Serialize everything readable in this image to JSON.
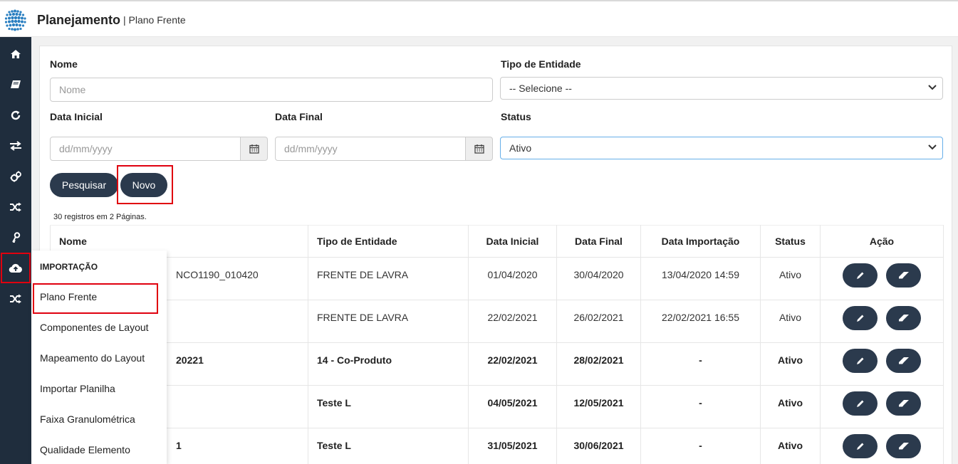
{
  "header": {
    "title": "Planejamento",
    "subtitle": "| Plano Frente"
  },
  "sidebar": {
    "icons": [
      "home-icon",
      "book-icon",
      "refresh-icon",
      "exchange-icon",
      "gears-icon",
      "shuffle-icon",
      "key-icon",
      "cloud-upload-icon",
      "random-icon"
    ]
  },
  "flyout": {
    "heading": "IMPORTAÇÃO",
    "items": [
      "Plano Frente",
      "Componentes de Layout",
      "Mapeamento do Layout",
      "Importar Planilha",
      "Faixa Granulométrica",
      "Qualidade Elemento"
    ]
  },
  "filters": {
    "nome_label": "Nome",
    "nome_placeholder": "Nome",
    "tipo_label": "Tipo de Entidade",
    "tipo_value": "-- Selecione --",
    "data_inicial_label": "Data Inicial",
    "data_final_label": "Data Final",
    "date_placeholder": "dd/mm/yyyy",
    "status_label": "Status",
    "status_value": "Ativo"
  },
  "buttons": {
    "search": "Pesquisar",
    "new": "Novo"
  },
  "records_text": "30 registros em 2 Páginas.",
  "table": {
    "headers": [
      "Nome",
      "Tipo de Entidade",
      "Data Inicial",
      "Data Final",
      "Data Importação",
      "Status",
      "Ação"
    ],
    "rows": [
      {
        "nome": "NCO1190_010420",
        "tipo": "FRENTE DE LAVRA",
        "data_inicial": "01/04/2020",
        "data_final": "30/04/2020",
        "data_importacao": "13/04/2020 14:59",
        "status": "Ativo",
        "bold": false
      },
      {
        "nome": "",
        "tipo": "FRENTE DE LAVRA",
        "data_inicial": "22/02/2021",
        "data_final": "26/02/2021",
        "data_importacao": "22/02/2021 16:55",
        "status": "Ativo",
        "bold": false
      },
      {
        "nome": "20221",
        "tipo": "14 - Co-Produto",
        "data_inicial": "22/02/2021",
        "data_final": "28/02/2021",
        "data_importacao": "-",
        "status": "Ativo",
        "bold": true
      },
      {
        "nome": "",
        "tipo": "Teste L",
        "data_inicial": "04/05/2021",
        "data_final": "12/05/2021",
        "data_importacao": "-",
        "status": "Ativo",
        "bold": true
      },
      {
        "nome": "1",
        "tipo": "Teste L",
        "data_inicial": "31/05/2021",
        "data_final": "30/06/2021",
        "data_importacao": "-",
        "status": "Ativo",
        "bold": true
      }
    ]
  },
  "colors": {
    "sidebar": "#1f2d3d",
    "button": "#2b3a4d",
    "highlight": "#e0000f"
  }
}
